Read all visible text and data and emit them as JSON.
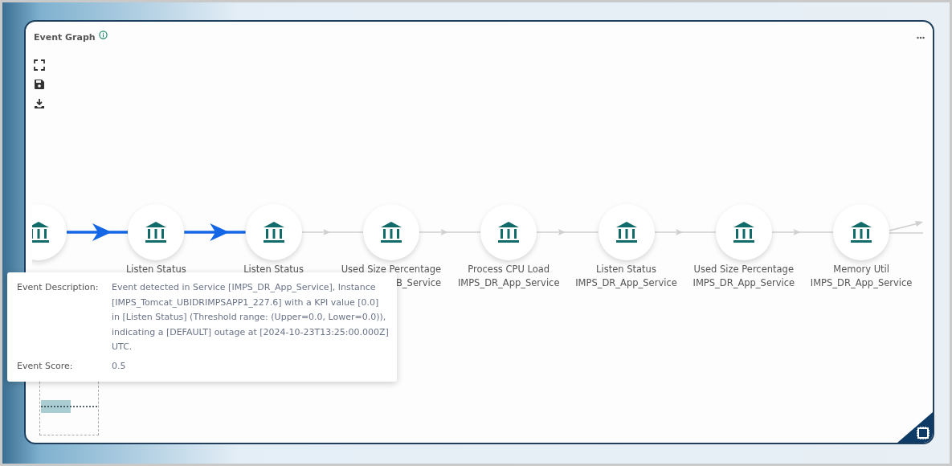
{
  "panel": {
    "title": "Event Graph"
  },
  "nodes": [
    {
      "kind": "service"
    },
    {
      "kind": "service",
      "title": "Listen Status"
    },
    {
      "kind": "service",
      "title": "Listen Status"
    },
    {
      "kind": "service",
      "title": "Used Size Percentage",
      "subtitle": "B_Service"
    },
    {
      "kind": "service",
      "title": "Process CPU Load",
      "subtitle": "IMPS_DR_App_Service"
    },
    {
      "kind": "service",
      "title": "Listen Status",
      "subtitle": "IMPS_DR_App_Service"
    },
    {
      "kind": "service",
      "title": "Used Size Percentage",
      "subtitle": "IMPS_DR_App_Service"
    },
    {
      "kind": "service",
      "title": "Memory Util",
      "subtitle": "IMPS_DR_App_Service"
    }
  ],
  "edges": [
    {
      "highlighted": true
    },
    {
      "highlighted": true
    },
    {
      "highlighted": false
    },
    {
      "highlighted": false
    },
    {
      "highlighted": false
    },
    {
      "highlighted": false
    },
    {
      "highlighted": false
    },
    {
      "highlighted": false
    }
  ],
  "tooltip": [
    {
      "label": "Event Description:",
      "value": "Event detected in Service [IMPS_DR_App_Service], Instance [IMPS_Tomcat_UBIDRIMPSAPP1_227.6] with a KPI value [0.0] in [Listen Status] (Threshold range: (Upper=0.0, Lower=0.0)), indicating a [DEFAULT] outage at [2024-10-23T13:25:00.000Z] UTC."
    },
    {
      "label": "Event Score:",
      "value": "0.5"
    }
  ]
}
